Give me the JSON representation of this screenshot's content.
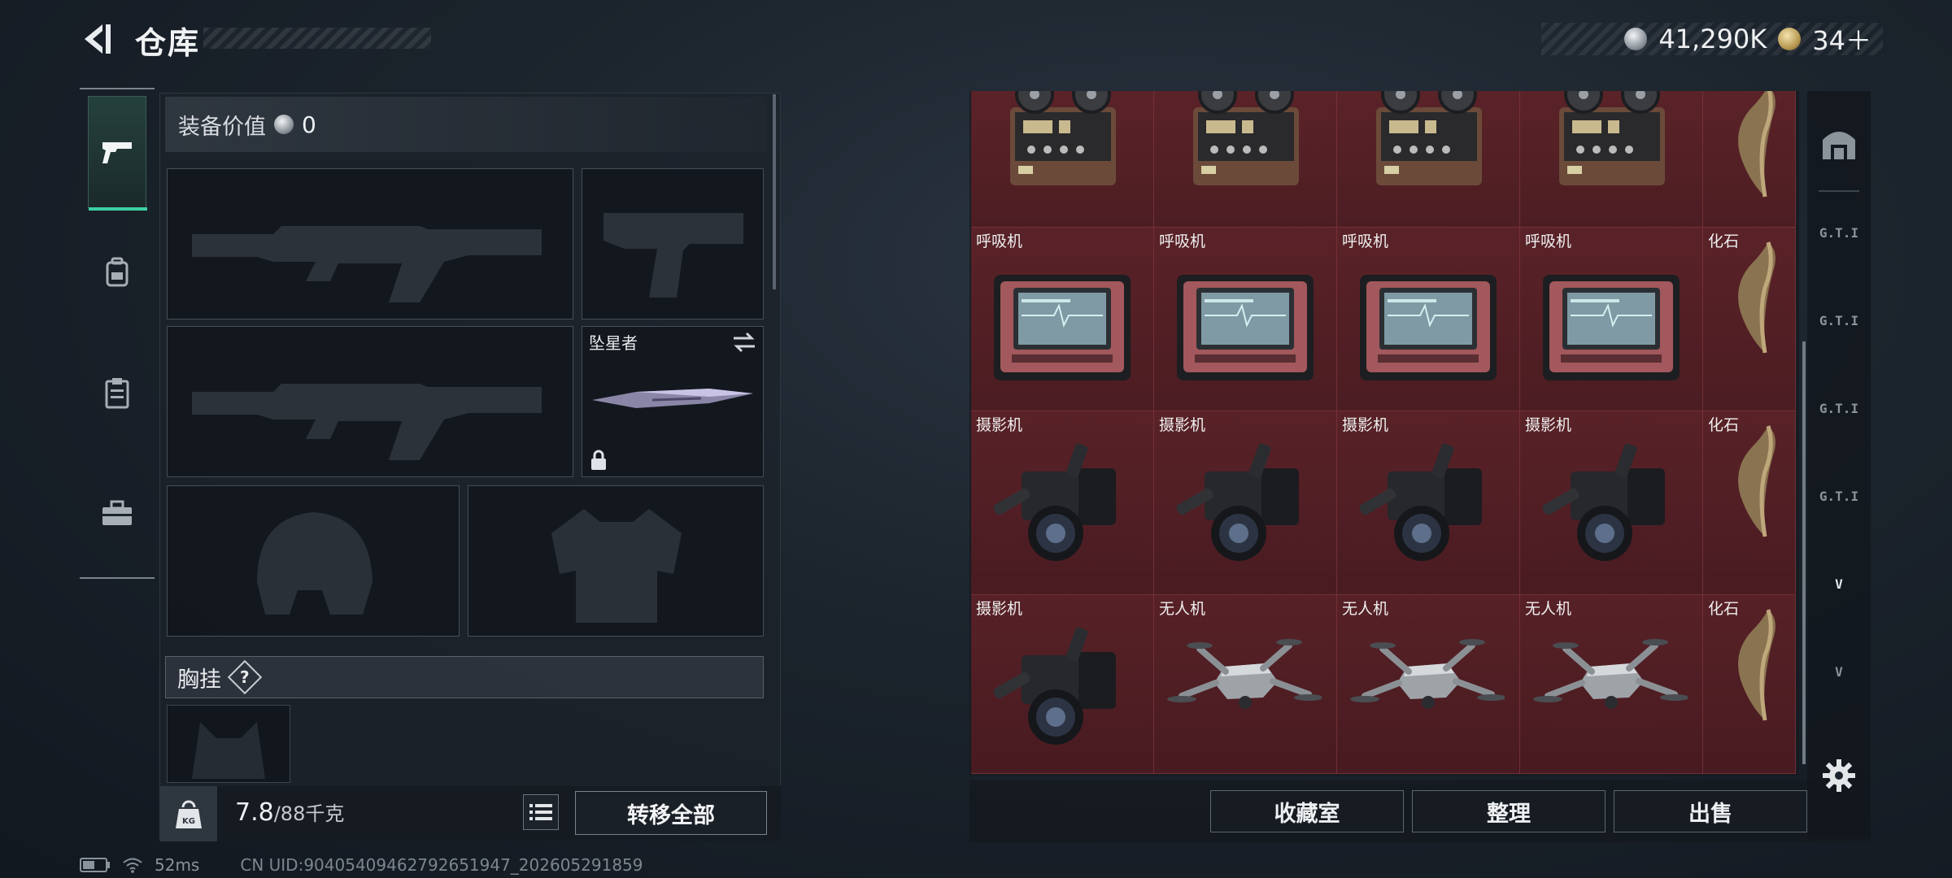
{
  "header": {
    "title": "仓库",
    "currency": [
      {
        "icon": "silver-coin-icon",
        "value": "41,290K"
      },
      {
        "icon": "gold-coin-icon",
        "value": "34＋"
      }
    ]
  },
  "side_tabs": [
    {
      "icon": "pistol-icon",
      "active": true
    },
    {
      "icon": "backpack-icon",
      "active": false
    },
    {
      "icon": "clipboard-icon",
      "active": false
    },
    {
      "icon": "toolbox-icon",
      "active": false
    }
  ],
  "loadout": {
    "equip_value_label": "装备价值",
    "equip_value": "0",
    "slots": {
      "primary_1": "",
      "pistol": "",
      "primary_2": "",
      "melee": "坠星者",
      "helmet": "",
      "armor": ""
    },
    "chest_rig_label": "胸挂",
    "chest_rig_help": "?",
    "weight_current": "7.8",
    "weight_capacity": "/88千克",
    "transfer_all": "转移全部"
  },
  "status": {
    "ping": "52ms",
    "uid": "CN UID:90405409462792651947_202605291859"
  },
  "storage": {
    "rows": [
      [
        {
          "name": "",
          "item": "tape-recorder"
        },
        {
          "name": "",
          "item": "tape-recorder"
        },
        {
          "name": "",
          "item": "tape-recorder"
        },
        {
          "name": "",
          "item": "tape-recorder"
        },
        {
          "name": "",
          "item": "fossil-claw"
        }
      ],
      [
        {
          "name": "呼吸机",
          "item": "ventilator"
        },
        {
          "name": "呼吸机",
          "item": "ventilator"
        },
        {
          "name": "呼吸机",
          "item": "ventilator"
        },
        {
          "name": "呼吸机",
          "item": "ventilator"
        },
        {
          "name": "化石",
          "item": "fossil-claw"
        }
      ],
      [
        {
          "name": "摄影机",
          "item": "camera"
        },
        {
          "name": "摄影机",
          "item": "camera"
        },
        {
          "name": "摄影机",
          "item": "camera"
        },
        {
          "name": "摄影机",
          "item": "camera"
        },
        {
          "name": "化石",
          "item": "fossil-claw"
        }
      ],
      [
        {
          "name": "摄影机",
          "item": "camera"
        },
        {
          "name": "无人机",
          "item": "drone"
        },
        {
          "name": "无人机",
          "item": "drone"
        },
        {
          "name": "无人机",
          "item": "drone"
        },
        {
          "name": "化石",
          "item": "fossil-claw"
        }
      ]
    ],
    "actions": {
      "collection": "收藏室",
      "sort": "整理",
      "sell": "出售"
    }
  },
  "filters": [
    {
      "icon": "arch-icon",
      "label": ""
    },
    {
      "icon": "gti-filter-1-icon",
      "label": "G.T.I"
    },
    {
      "icon": "gti-filter-2-icon",
      "label": "G.T.I"
    },
    {
      "icon": "gti-filter-3-icon",
      "label": "G.T.I"
    },
    {
      "icon": "gti-filter-4-icon",
      "label": "G.T.I"
    },
    {
      "icon": "v-filter-1-icon",
      "label": "V"
    },
    {
      "icon": "v-filter-2-icon",
      "label": "V"
    },
    {
      "icon": "settings-gear-icon",
      "label": ""
    }
  ],
  "colors": {
    "accent": "#3ed0a2",
    "storage_bg": "#4a1d22"
  }
}
